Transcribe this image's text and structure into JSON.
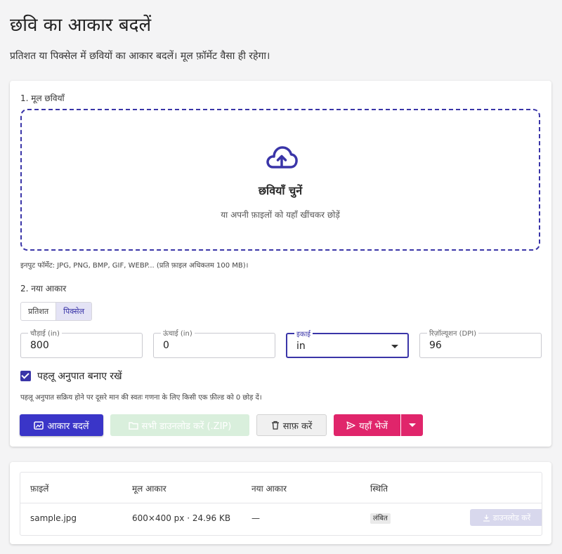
{
  "page": {
    "title": "छवि का आकार बदलें",
    "subtitle": "प्रतिशत या पिक्सेल में छवियों का आकार बदलें। मूल फ़ॉर्मेट वैसा ही रहेगा।"
  },
  "source": {
    "section_label": "1. मूल छवियाँ",
    "dropzone_title": "छवियाँ चुनें",
    "dropzone_subtitle": "या अपनी फ़ाइलों को यहाँ खींचकर छोड़ें",
    "formats_note": "इनपुट फॉर्मेट: JPG, PNG, BMP, GIF, WEBP... (प्रति फ़ाइल अधिकतम 100 MB)।",
    "icon": "cloud-upload-icon"
  },
  "size": {
    "section_label": "2. नया आकार",
    "mode_options": [
      "प्रतिशत",
      "पिक्सेल"
    ],
    "mode_selected": "पिक्सेल",
    "width": {
      "label": "चौड़ाई (in)",
      "value": "800"
    },
    "height": {
      "label": "ऊंचाई (in)",
      "value": "0"
    },
    "unit": {
      "label": "इकाई",
      "value": "in"
    },
    "resolution": {
      "label": "रिज़ॉल्यूशन (DPI)",
      "value": "96"
    },
    "keep_ratio": {
      "label": "पहलू अनुपात बनाए रखें",
      "checked": true
    },
    "hint": "पहलू अनुपात सक्रिय होने पर दूसरे मान की स्वतः गणना के लिए किसी एक फ़ील्ड को 0 छोड़ दें।"
  },
  "actions": {
    "resize_label": "आकार बदलें",
    "download_all_label": "सभी डाउनलोड करें (.ZIP)",
    "clear_label": "साफ़ करें",
    "send_label": "यहाँ भेजें"
  },
  "table": {
    "headers": [
      "फ़ाइलें",
      "मूल आकार",
      "नया आकार",
      "स्थिति"
    ],
    "rows": [
      {
        "file": "sample.jpg",
        "original": "600×400 px · 24.96 KB",
        "new": "—",
        "status": "लंबित",
        "download_label": "डाउनलोड करें"
      }
    ]
  },
  "colors": {
    "accent": "#3a35c8",
    "send": "#e0256b",
    "zip_disabled": "#d9efdc"
  }
}
